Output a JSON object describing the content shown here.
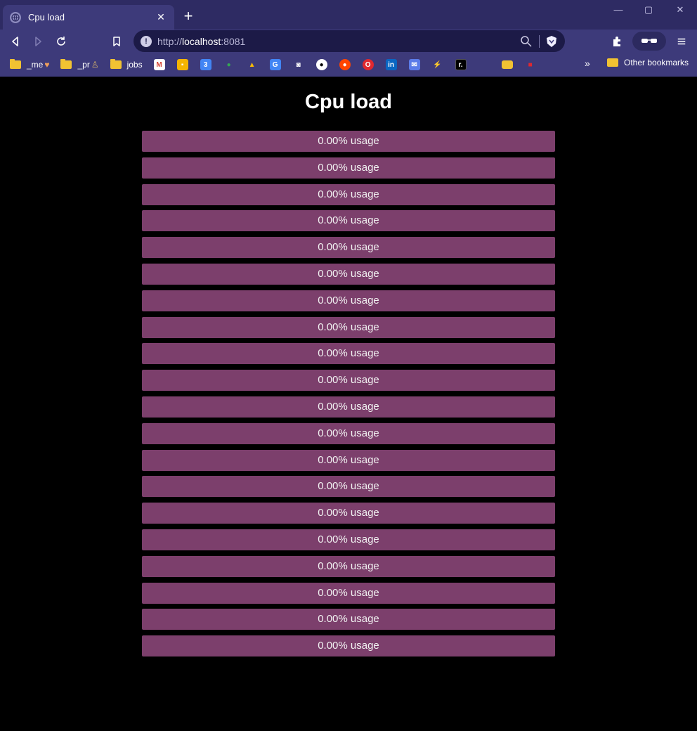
{
  "browser": {
    "tab_title": "Cpu load",
    "url_scheme": "http://",
    "url_host": "localhost",
    "url_port": ":8081",
    "bookmarks": [
      {
        "label": "_me",
        "icon": "folder-icon"
      },
      {
        "label": "_pr",
        "icon": "folder-icon"
      },
      {
        "label": "jobs",
        "icon": "folder-icon"
      }
    ],
    "bookmark_icons": [
      "gmail-icon",
      "keep-icon",
      "calendar-icon",
      "maps-icon",
      "drive-icon",
      "translate-icon",
      "camera-icon",
      "github-icon",
      "reddit-icon",
      "opera-icon",
      "linkedin-icon",
      "mail-icon",
      "flow-icon",
      "r-icon",
      "blank-icon",
      "folder-icon",
      "red-icon"
    ],
    "other_bookmarks": "Other bookmarks",
    "accent": "#3d3a7a"
  },
  "page": {
    "title": "Cpu load",
    "cpus": [
      {
        "usage": 0.0,
        "label": "0.00% usage"
      },
      {
        "usage": 0.0,
        "label": "0.00% usage"
      },
      {
        "usage": 0.0,
        "label": "0.00% usage"
      },
      {
        "usage": 0.0,
        "label": "0.00% usage"
      },
      {
        "usage": 0.0,
        "label": "0.00% usage"
      },
      {
        "usage": 0.0,
        "label": "0.00% usage"
      },
      {
        "usage": 0.0,
        "label": "0.00% usage"
      },
      {
        "usage": 0.0,
        "label": "0.00% usage"
      },
      {
        "usage": 0.0,
        "label": "0.00% usage"
      },
      {
        "usage": 0.0,
        "label": "0.00% usage"
      },
      {
        "usage": 0.0,
        "label": "0.00% usage"
      },
      {
        "usage": 0.0,
        "label": "0.00% usage"
      },
      {
        "usage": 0.0,
        "label": "0.00% usage"
      },
      {
        "usage": 0.0,
        "label": "0.00% usage"
      },
      {
        "usage": 0.0,
        "label": "0.00% usage"
      },
      {
        "usage": 0.0,
        "label": "0.00% usage"
      },
      {
        "usage": 0.0,
        "label": "0.00% usage"
      },
      {
        "usage": 0.0,
        "label": "0.00% usage"
      },
      {
        "usage": 0.0,
        "label": "0.00% usage"
      },
      {
        "usage": 0.0,
        "label": "0.00% usage"
      }
    ],
    "bar_color": "#7c3f6c"
  }
}
